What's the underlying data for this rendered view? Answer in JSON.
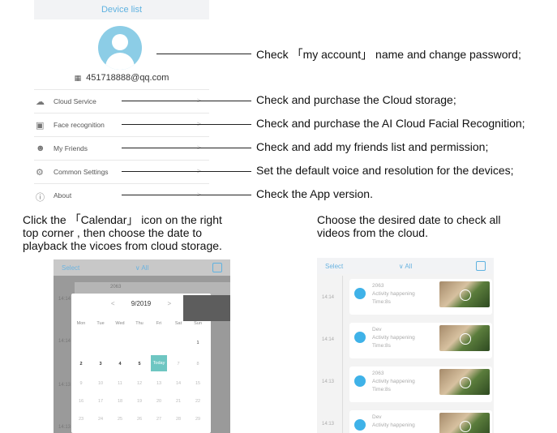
{
  "account": {
    "title": "Device list",
    "email": "451718888@qq.com",
    "qr_icon": "qr-code-icon",
    "menu": [
      {
        "label": "Cloud Service",
        "icon": "cloud-icon"
      },
      {
        "label": "Face recognition",
        "icon": "face-scan-icon"
      },
      {
        "label": "My Friends",
        "icon": "friends-icon"
      },
      {
        "label": "Common Settings",
        "icon": "settings-icon"
      },
      {
        "label": "About",
        "icon": "info-icon"
      }
    ]
  },
  "annotations": [
    "Check  「my account」 name and change password;",
    "Check and purchase the Cloud storage;",
    "Check and purchase the AI Cloud Facial Recognition;",
    "Check and add my friends list and permission;",
    "Set the default voice and resolution for the devices;",
    "Check the App version."
  ],
  "instructions": {
    "left": [
      "Click the  「Calendar」 icon on the right",
      "top corner , then choose the date to",
      "playback the vicoes from cloud storage."
    ],
    "right": [
      "Choose the desired date to check all",
      "videos from the cloud."
    ]
  },
  "left_phone": {
    "select": "Select",
    "filter": "∨ All",
    "card_title": "2063",
    "month": "9/2019",
    "weekdays": [
      "Mon",
      "Tue",
      "Wed",
      "Thu",
      "Fri",
      "Sat",
      "Sun"
    ],
    "week1": [
      "",
      "",
      "",
      "",
      "",
      "",
      "1"
    ],
    "week2": [
      "2",
      "3",
      "4",
      "5",
      "Today",
      "7",
      "8"
    ],
    "week3": [
      "9",
      "10",
      "11",
      "12",
      "13",
      "14",
      "15"
    ],
    "week4": [
      "16",
      "17",
      "18",
      "19",
      "20",
      "21",
      "22"
    ],
    "week5": [
      "23",
      "24",
      "25",
      "26",
      "27",
      "28",
      "29"
    ],
    "times": [
      "14:14",
      "14:14",
      "14:13",
      "14:13"
    ]
  },
  "right_phone": {
    "select": "Select",
    "filter": "∨ All",
    "cards": [
      {
        "time": "14:14",
        "name": "2063",
        "event": "Activity happening",
        "duration": "Time:8s"
      },
      {
        "time": "14:14",
        "name": "Dev",
        "event": "Activity happening",
        "duration": "Time:8s"
      },
      {
        "time": "14:13",
        "name": "2063",
        "event": "Activity happening",
        "duration": "Time:8s"
      },
      {
        "time": "14:13",
        "name": "Dev",
        "event": "Activity happening",
        "duration": ""
      }
    ]
  }
}
